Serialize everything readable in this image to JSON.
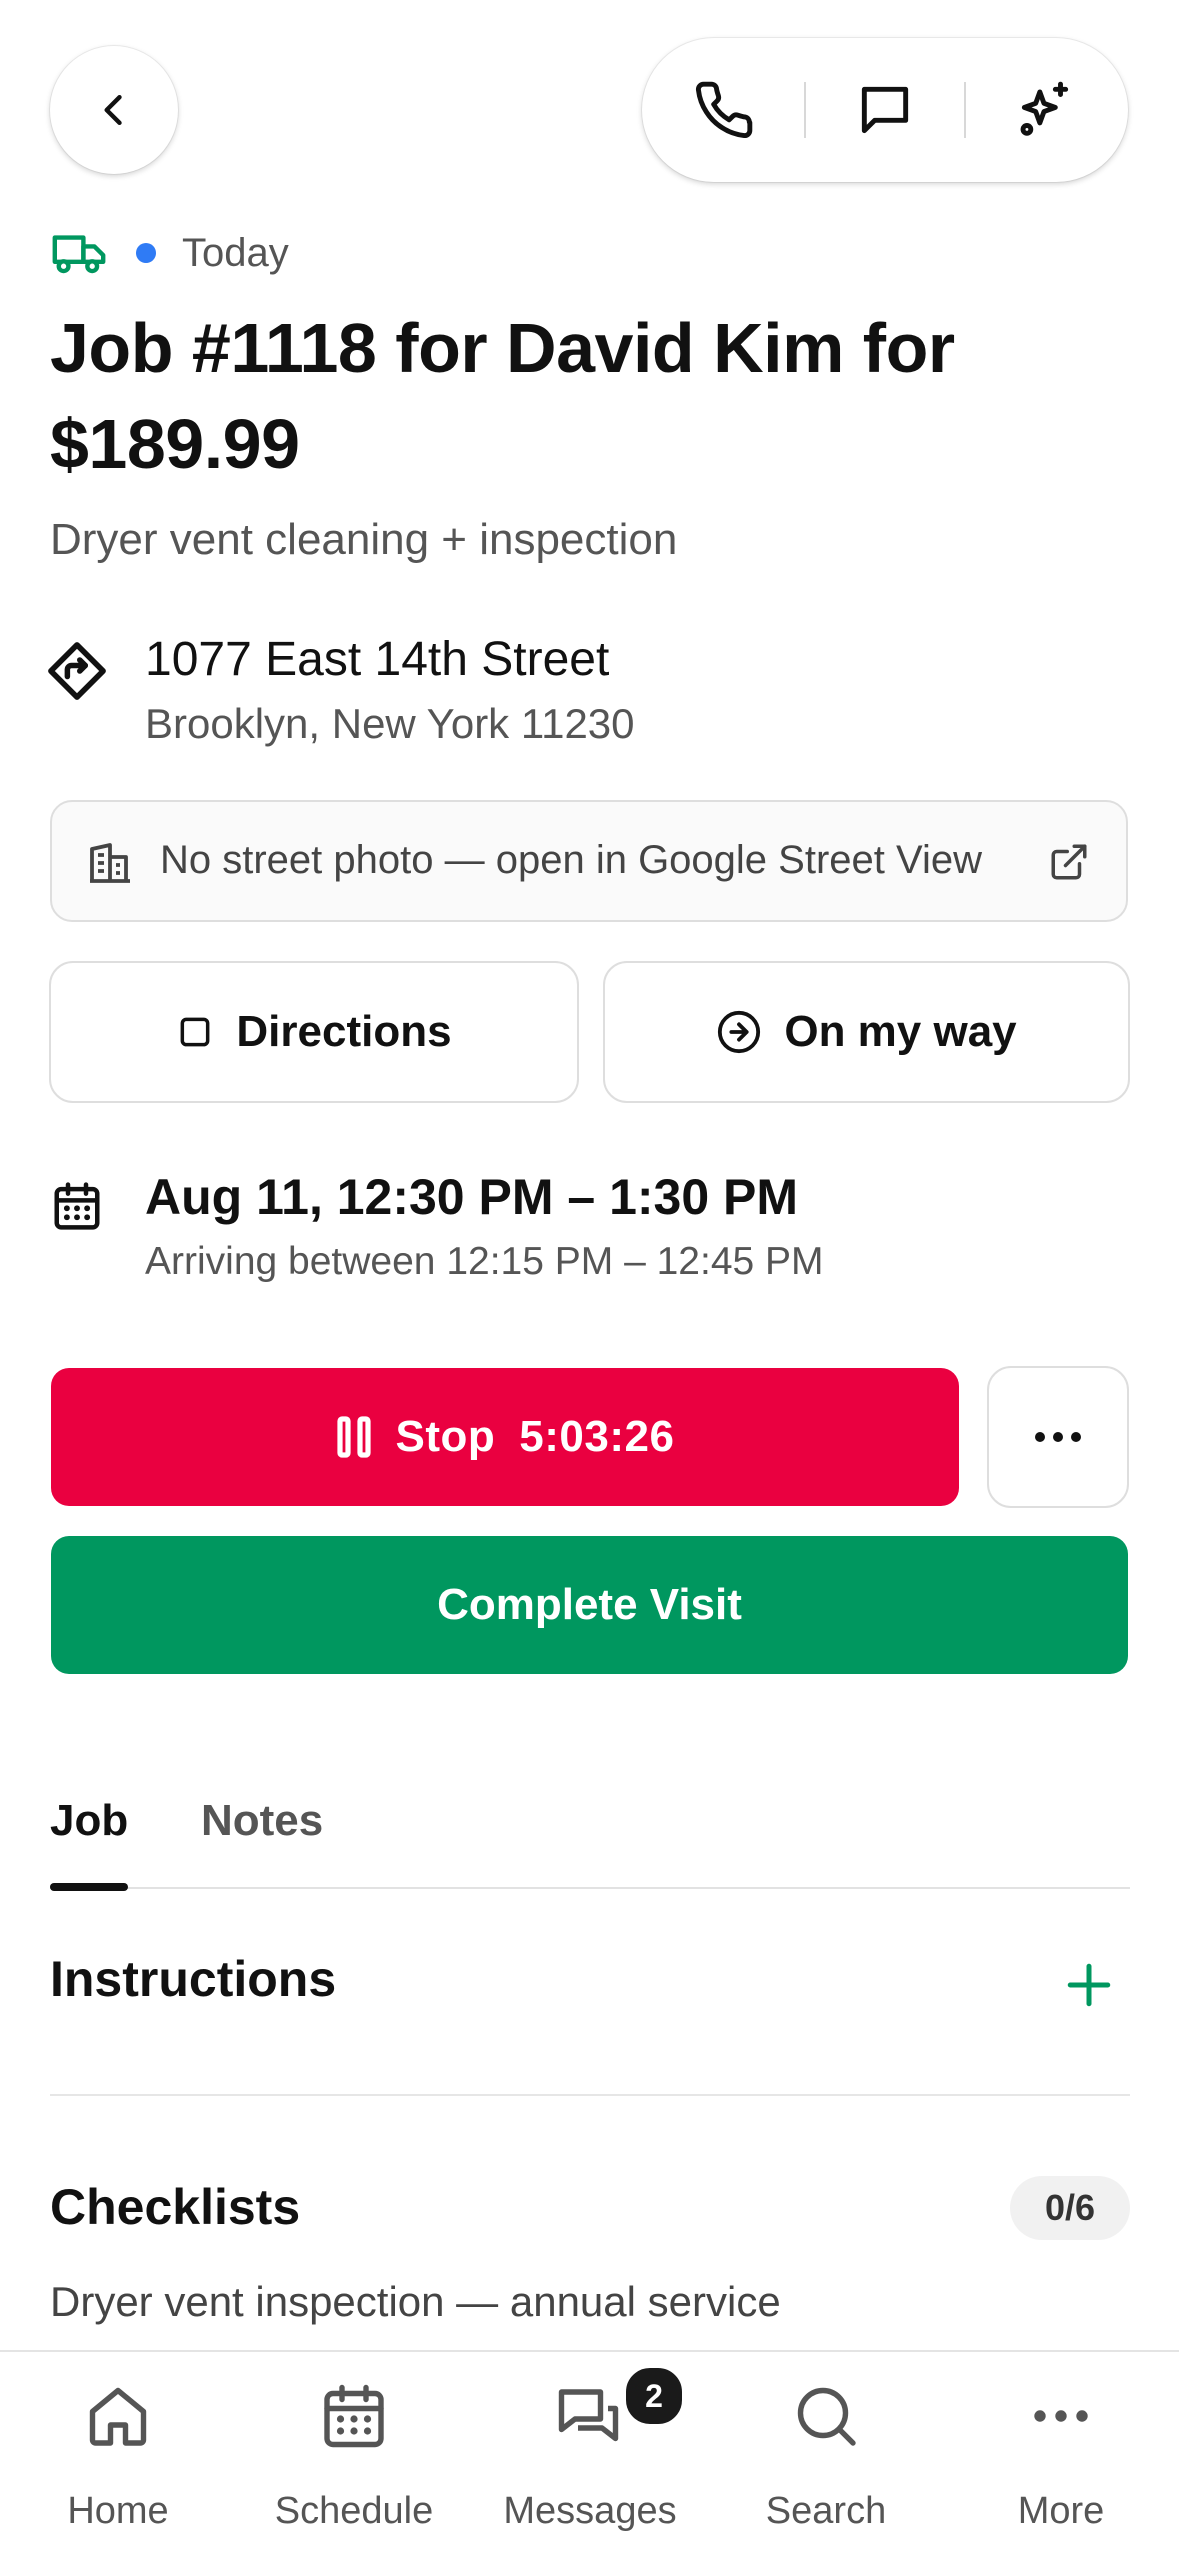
{
  "status": {
    "label": "Today",
    "dot_color": "#2f7bf5",
    "truck_color": "#00975f"
  },
  "job": {
    "title": "Job #1118 for David Kim for $189.99",
    "description": "Dryer vent cleaning + inspection"
  },
  "address": {
    "line1": "1077 East 14th Street",
    "line2": "Brooklyn, New York 11230"
  },
  "street_view": {
    "label": "No street photo — open in Google Street View"
  },
  "buttons": {
    "directions": "Directions",
    "on_my_way": "On my way",
    "stop": "Stop",
    "timer": "5:03:26",
    "complete": "Complete Visit"
  },
  "schedule": {
    "time": "Aug 11, 12:30 PM – 1:30 PM",
    "arrival": "Arriving between 12:15 PM – 12:45 PM"
  },
  "tabs": [
    {
      "label": "Job",
      "active": true
    },
    {
      "label": "Notes",
      "active": false
    }
  ],
  "sections": {
    "instructions": "Instructions",
    "checklists": "Checklists",
    "checklist_count": "0/6",
    "checklist_item": "Dryer vent inspection — annual service"
  },
  "nav": {
    "items": [
      {
        "label": "Home",
        "icon": "home-icon"
      },
      {
        "label": "Schedule",
        "icon": "calendar-icon"
      },
      {
        "label": "Messages",
        "icon": "messages-icon",
        "badge": "2"
      },
      {
        "label": "Search",
        "icon": "search-icon"
      },
      {
        "label": "More",
        "icon": "more-icon"
      }
    ]
  },
  "colors": {
    "stop": "#ea0040",
    "complete": "#00975f",
    "accent_green": "#00975f"
  }
}
